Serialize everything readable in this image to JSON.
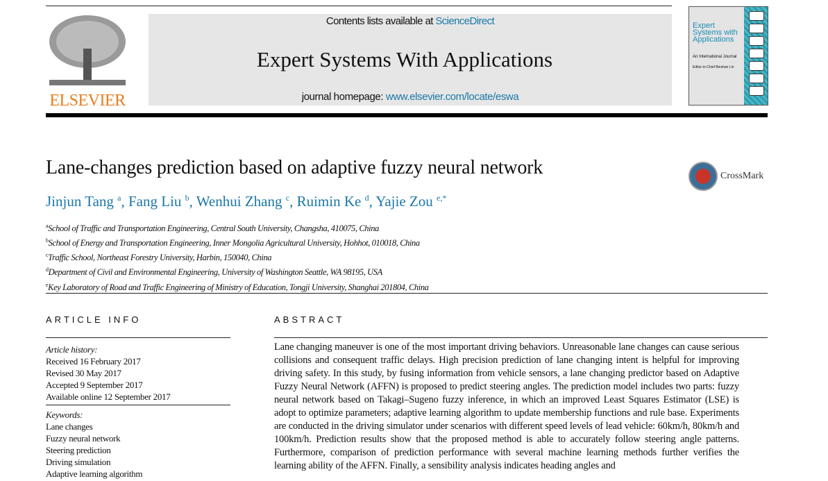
{
  "header": {
    "contents_prefix": "Contents lists available at ",
    "contents_link": "ScienceDirect",
    "journal_title": "Expert Systems With Applications",
    "homepage_prefix": "journal homepage: ",
    "homepage_link": "www.elsevier.com/locate/eswa",
    "publisher": "ELSEVIER"
  },
  "cover": {
    "title": "Expert Systems with Applications",
    "subtitle": "An International Journal",
    "editor": "Editor-in-Chief Binshan Lin"
  },
  "article": {
    "title": "Lane-changes prediction based on adaptive fuzzy neural network",
    "crossmark": "CrossMark",
    "authors": [
      {
        "name": "Jinjun Tang",
        "sup": "a"
      },
      {
        "name": "Fang Liu",
        "sup": "b"
      },
      {
        "name": "Wenhui Zhang",
        "sup": "c"
      },
      {
        "name": "Ruimin Ke",
        "sup": "d"
      },
      {
        "name": "Yajie Zou",
        "sup": "e,*"
      }
    ],
    "affiliations": [
      {
        "sup": "a",
        "text": "School of Traffic and Transportation Engineering, Central South University, Changsha, 410075, China"
      },
      {
        "sup": "b",
        "text": "School of Energy and Transportation Engineering, Inner Mongolia Agricultural University, Hohhot, 010018, China"
      },
      {
        "sup": "c",
        "text": "Traffic School, Northeast Forestry University, Harbin, 150040, China"
      },
      {
        "sup": "d",
        "text": "Department of Civil and Environmental Engineering, University of Washington Seattle, WA 98195, USA"
      },
      {
        "sup": "e",
        "text": "Key Laboratory of Road and Traffic Engineering of Ministry of Education, Tongji University, Shanghai 201804, China"
      }
    ]
  },
  "info": {
    "heading": "ARTICLE INFO",
    "history_label": "Article history:",
    "history": [
      "Received 16 February 2017",
      "Revised 30 May 2017",
      "Accepted 9 September 2017",
      "Available online 12 September 2017"
    ],
    "keywords_label": "Keywords:",
    "keywords": [
      "Lane changes",
      "Fuzzy neural network",
      "Steering prediction",
      "Driving simulation",
      "Adaptive learning algorithm"
    ]
  },
  "abstract": {
    "heading": "ABSTRACT",
    "text": "Lane changing maneuver is one of the most important driving behaviors. Unreasonable lane changes can cause serious collisions and consequent traffic delays. High precision prediction of lane changing intent is helpful for improving driving safety. In this study, by fusing information from vehicle sensors, a lane changing predictor based on Adaptive Fuzzy Neural Network (AFFN) is proposed to predict steering angles. The prediction model includes two parts: fuzzy neural network based on Takagi–Sugeno fuzzy inference, in which an improved Least Squares Estimator (LSE) is adopt to optimize parameters; adaptive learning algorithm to update membership functions and rule base. Experiments are conducted in the driving simulator under scenarios with different speed levels of lead vehicle: 60km/h, 80km/h and 100km/h. Prediction results show that the proposed method is able to accurately follow steering angle patterns. Furthermore, comparison of prediction performance with several machine learning methods further verifies the learning ability of the AFFN. Finally, a sensibility analysis indicates heading angles and"
  }
}
